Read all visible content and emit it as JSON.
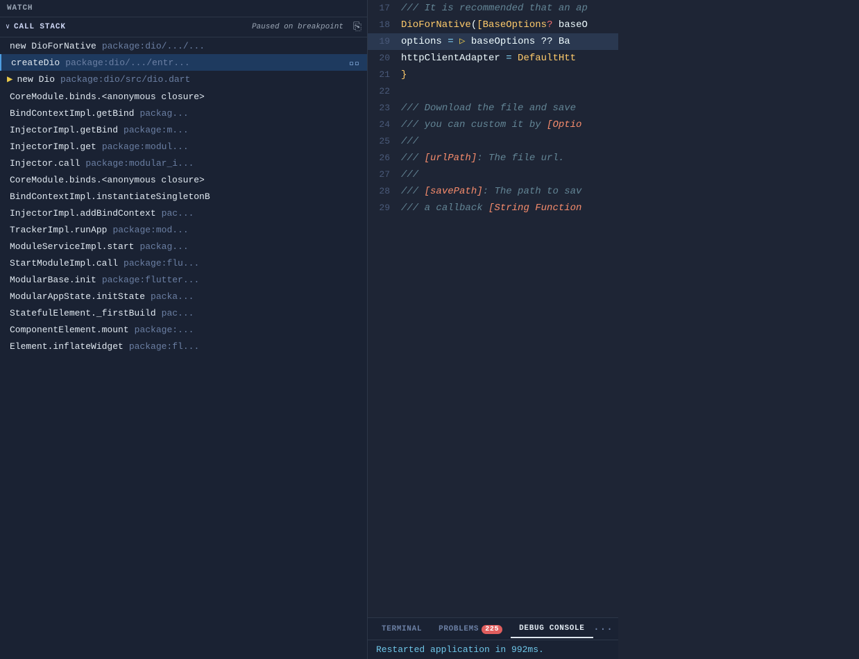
{
  "watch": {
    "label": "WATCH"
  },
  "callStack": {
    "chevron": "∨",
    "title": "CALL STACK",
    "status": "Paused on breakpoint",
    "copyIcon": "⧉"
  },
  "stackItems": [
    {
      "func": "new DioForNative",
      "pkg": "package:dio/.../...",
      "icon": "",
      "selected": false,
      "playIcon": false
    },
    {
      "func": "createDio",
      "pkg": "package:dio/.../entr...",
      "icon": "↺⃝",
      "selected": true,
      "playIcon": false
    },
    {
      "func": "new Dio",
      "pkg": "package:dio/src/dio.dart",
      "icon": "",
      "selected": false,
      "playIcon": true
    },
    {
      "func": "CoreModule.binds.<anonymous closure>",
      "pkg": "",
      "icon": "",
      "selected": false,
      "playIcon": false
    },
    {
      "func": "BindContextImpl.getBind",
      "pkg": "packag...",
      "icon": "",
      "selected": false,
      "playIcon": false
    },
    {
      "func": "InjectorImpl.getBind",
      "pkg": "package:m...",
      "icon": "",
      "selected": false,
      "playIcon": false
    },
    {
      "func": "InjectorImpl.get",
      "pkg": "package:modul...",
      "icon": "",
      "selected": false,
      "playIcon": false
    },
    {
      "func": "Injector.call",
      "pkg": "package:modular_i...",
      "icon": "",
      "selected": false,
      "playIcon": false
    },
    {
      "func": "CoreModule.binds.<anonymous closure>",
      "pkg": "",
      "icon": "",
      "selected": false,
      "playIcon": false
    },
    {
      "func": "BindContextImpl.instantiateSingletonB",
      "pkg": "",
      "icon": "",
      "selected": false,
      "playIcon": false
    },
    {
      "func": "InjectorImpl.addBindContext",
      "pkg": "pac...",
      "icon": "",
      "selected": false,
      "playIcon": false
    },
    {
      "func": "TrackerImpl.runApp",
      "pkg": "package:mod...",
      "icon": "",
      "selected": false,
      "playIcon": false
    },
    {
      "func": "ModuleServiceImpl.start",
      "pkg": "packag...",
      "icon": "",
      "selected": false,
      "playIcon": false
    },
    {
      "func": "StartModuleImpl.call",
      "pkg": "package:flu...",
      "icon": "",
      "selected": false,
      "playIcon": false
    },
    {
      "func": "ModularBase.init",
      "pkg": "package:flutter...",
      "icon": "",
      "selected": false,
      "playIcon": false
    },
    {
      "func": "ModularAppState.initState",
      "pkg": "packa...",
      "icon": "",
      "selected": false,
      "playIcon": false
    },
    {
      "func": "StatefulElement._firstBuild",
      "pkg": "pac...",
      "icon": "",
      "selected": false,
      "playIcon": false
    },
    {
      "func": "ComponentElement.mount",
      "pkg": "package:...",
      "icon": "",
      "selected": false,
      "playIcon": false
    },
    {
      "func": "Element.inflateWidget",
      "pkg": "package:fl...",
      "icon": "",
      "selected": false,
      "playIcon": false
    }
  ],
  "codeLines": [
    {
      "num": "17",
      "tokens": [
        {
          "t": "/// ",
          "c": "comment"
        },
        {
          "t": "It is ",
          "c": "comment"
        },
        {
          "t": "recommended",
          "c": "comment"
        },
        {
          "t": " that an ap",
          "c": "comment"
        }
      ],
      "highlight": false
    },
    {
      "num": "18",
      "tokens": [
        {
          "t": "DioForNative",
          "c": "class"
        },
        {
          "t": "(",
          "c": "white"
        },
        {
          "t": "[",
          "c": "bracket"
        },
        {
          "t": "BaseOptions",
          "c": "class"
        },
        {
          "t": "?",
          "c": "null"
        },
        {
          "t": " baseO",
          "c": "white"
        }
      ],
      "highlight": false
    },
    {
      "num": "19",
      "tokens": [
        {
          "t": "    options ",
          "c": "white"
        },
        {
          "t": "= ",
          "c": "blue"
        },
        {
          "t": "▷ ",
          "c": "arrow"
        },
        {
          "t": "baseOptions ",
          "c": "white"
        },
        {
          "t": "?? Ba",
          "c": "white"
        }
      ],
      "highlight": true
    },
    {
      "num": "20",
      "tokens": [
        {
          "t": "    httpClientAdapter ",
          "c": "white"
        },
        {
          "t": "= ",
          "c": "blue"
        },
        {
          "t": "DefaultHtt",
          "c": "class"
        }
      ],
      "highlight": false
    },
    {
      "num": "21",
      "tokens": [
        {
          "t": "}",
          "c": "bracket"
        }
      ],
      "highlight": false
    },
    {
      "num": "22",
      "tokens": [],
      "highlight": false
    },
    {
      "num": "23",
      "tokens": [
        {
          "t": "/// ",
          "c": "comment"
        },
        {
          "t": "Download",
          "c": "comment"
        },
        {
          "t": " the file and save",
          "c": "comment"
        }
      ],
      "highlight": false
    },
    {
      "num": "24",
      "tokens": [
        {
          "t": "/// ",
          "c": "comment"
        },
        {
          "t": "you can custom it by ",
          "c": "comment"
        },
        {
          "t": "[Optio",
          "c": "param"
        }
      ],
      "highlight": false
    },
    {
      "num": "25",
      "tokens": [
        {
          "t": "///",
          "c": "comment"
        }
      ],
      "highlight": false
    },
    {
      "num": "26",
      "tokens": [
        {
          "t": "/// ",
          "c": "comment"
        },
        {
          "t": "[urlPath]",
          "c": "param"
        },
        {
          "t": ": ",
          "c": "comment"
        },
        {
          "t": "The file url.",
          "c": "comment"
        }
      ],
      "highlight": false
    },
    {
      "num": "27",
      "tokens": [
        {
          "t": "///",
          "c": "comment"
        }
      ],
      "highlight": false
    },
    {
      "num": "28",
      "tokens": [
        {
          "t": "/// ",
          "c": "comment"
        },
        {
          "t": "[savePath]",
          "c": "param"
        },
        {
          "t": ": ",
          "c": "comment"
        },
        {
          "t": "The path to sav",
          "c": "comment"
        }
      ],
      "highlight": false
    },
    {
      "num": "29",
      "tokens": [
        {
          "t": "/// ",
          "c": "comment"
        },
        {
          "t": "a callback ",
          "c": "comment"
        },
        {
          "t": "[String Function",
          "c": "param"
        }
      ],
      "highlight": false
    }
  ],
  "bottomTabs": [
    {
      "label": "TERMINAL",
      "active": false,
      "badge": null
    },
    {
      "label": "PROBLEMS",
      "active": false,
      "badge": "225"
    },
    {
      "label": "DEBUG CONSOLE",
      "active": true,
      "badge": null
    }
  ],
  "consoleMessage": "Restarted application in 992ms.",
  "moreIcon": "···"
}
